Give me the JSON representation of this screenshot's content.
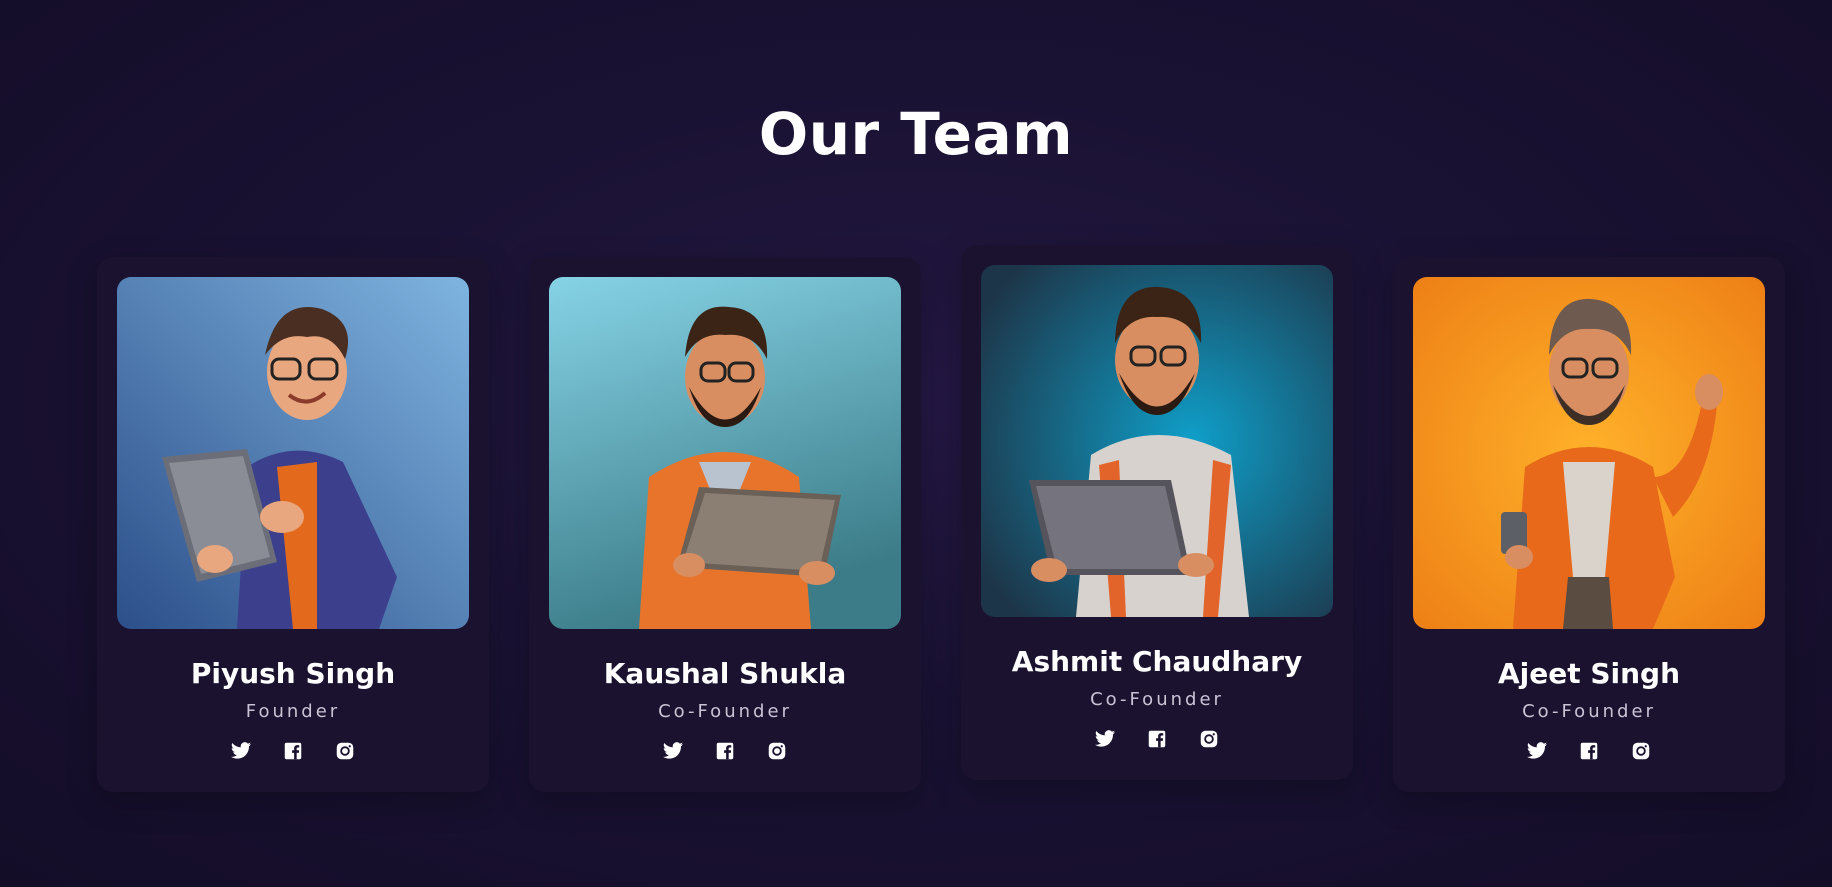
{
  "section": {
    "title": "Our Team"
  },
  "team": [
    {
      "name": "Piyush Singh",
      "role": "Founder",
      "photo_theme": "blue",
      "accent": "#3f73b8"
    },
    {
      "name": "Kaushal Shukla",
      "role": "Co-Founder",
      "photo_theme": "teal",
      "accent": "#5eb6c8"
    },
    {
      "name": "Ashmit Chaudhary",
      "role": "Co-Founder",
      "photo_theme": "cyan",
      "accent": "#0b7ea6"
    },
    {
      "name": "Ajeet Singh",
      "role": "Co-Founder",
      "photo_theme": "orange",
      "accent": "#f29a1e"
    }
  ],
  "social_icons": [
    "twitter-icon",
    "facebook-icon",
    "instagram-icon"
  ],
  "colors": {
    "background": "#1a1233",
    "card": "#1b1230",
    "title": "#ffffff",
    "role_text": "#c9c3d6"
  }
}
